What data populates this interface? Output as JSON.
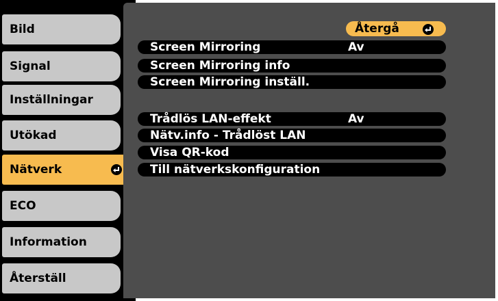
{
  "sidebar": {
    "items": [
      {
        "label": "Bild"
      },
      {
        "label": "Signal"
      },
      {
        "label": "Inställningar"
      },
      {
        "label": "Utökad"
      },
      {
        "label": "Nätverk"
      },
      {
        "label": "ECO"
      },
      {
        "label": "Information"
      },
      {
        "label": "Återställ"
      }
    ],
    "active_item": "Nätverk",
    "enter_icon": "enter-icon"
  },
  "main": {
    "return_label": "Återgå",
    "return_icon": "enter-icon",
    "groups": [
      {
        "options": [
          {
            "label": "Screen Mirroring",
            "value": "Av"
          },
          {
            "label": "Screen Mirroring info",
            "value": ""
          },
          {
            "label": "Screen Mirroring inställ.",
            "value": ""
          }
        ]
      },
      {
        "options": [
          {
            "label": "Trådlös LAN-effekt",
            "value": "Av"
          },
          {
            "label": "Nätv.info - Trådlöst LAN",
            "value": ""
          },
          {
            "label": "Visa QR-kod",
            "value": ""
          },
          {
            "label": "Till nätverkskonfiguration",
            "value": ""
          }
        ]
      }
    ]
  },
  "colors": {
    "accent": "#f7bb4f",
    "tab_bg": "#c8c8c8",
    "panel_bg": "#4d4d4d",
    "option_bg": "#000000",
    "option_text": "#ffffff"
  }
}
